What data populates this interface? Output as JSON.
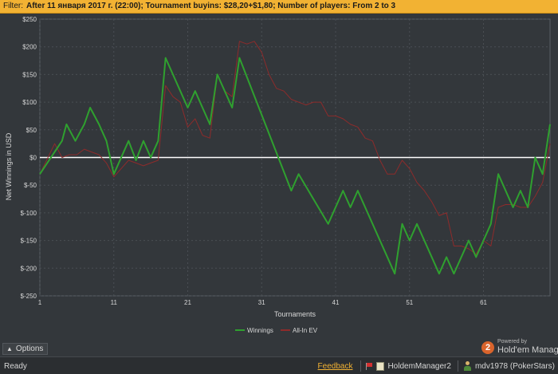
{
  "filter": {
    "label": "Filter:",
    "text": "After 11 января 2017 г. (22:00); Tournament buyins: $28,20+$1,80; Number of players: From 2 to 3"
  },
  "colors": {
    "filter_bg": "#f2b233",
    "background": "#33373b",
    "grid": "#4a4f54",
    "zero_line": "#ffffff",
    "winnings": "#2fa02f",
    "allin_ev": "#8e2b2b",
    "feedback": "#f2b233"
  },
  "chart_data": {
    "type": "line",
    "xlabel": "Tournaments",
    "ylabel": "Net Winnings in USD",
    "xlim": [
      1,
      70
    ],
    "ylim": [
      -250,
      250
    ],
    "x_ticks": [
      1,
      11,
      21,
      31,
      41,
      51,
      61
    ],
    "y_ticks": [
      {
        "value": 250,
        "label": "$250"
      },
      {
        "value": 200,
        "label": "$200"
      },
      {
        "value": 150,
        "label": "$150"
      },
      {
        "value": 100,
        "label": "$100"
      },
      {
        "value": 50,
        "label": "$50"
      },
      {
        "value": 0,
        "label": "$0"
      },
      {
        "value": -50,
        "label": "$-50"
      },
      {
        "value": -100,
        "label": "$-100"
      },
      {
        "value": -150,
        "label": "$-150"
      },
      {
        "value": -200,
        "label": "$-200"
      },
      {
        "value": -250,
        "label": "$-250"
      }
    ],
    "grid": true,
    "legend_position": "bottom-center",
    "series": [
      {
        "name": "Winnings",
        "color": "#2fa02f",
        "points": [
          [
            1,
            -30
          ],
          [
            4,
            30
          ],
          [
            4.6,
            60
          ],
          [
            5.8,
            30
          ],
          [
            7,
            60
          ],
          [
            7.8,
            90
          ],
          [
            9,
            60
          ],
          [
            10,
            30
          ],
          [
            11,
            -30
          ],
          [
            13,
            30
          ],
          [
            14,
            -5
          ],
          [
            15,
            30
          ],
          [
            16,
            0
          ],
          [
            17,
            30
          ],
          [
            18,
            180
          ],
          [
            20,
            120
          ],
          [
            21,
            90
          ],
          [
            22,
            120
          ],
          [
            24,
            60
          ],
          [
            25,
            150
          ],
          [
            27,
            90
          ],
          [
            28,
            180
          ],
          [
            35,
            -60
          ],
          [
            36,
            -30
          ],
          [
            40,
            -120
          ],
          [
            42,
            -60
          ],
          [
            43,
            -90
          ],
          [
            44,
            -60
          ],
          [
            49,
            -210
          ],
          [
            50,
            -120
          ],
          [
            51,
            -150
          ],
          [
            52,
            -120
          ],
          [
            55,
            -210
          ],
          [
            56,
            -180
          ],
          [
            57,
            -210
          ],
          [
            59,
            -150
          ],
          [
            60,
            -180
          ],
          [
            62,
            -120
          ],
          [
            63,
            -30
          ],
          [
            65,
            -90
          ],
          [
            66,
            -60
          ],
          [
            67,
            -90
          ],
          [
            68,
            0
          ],
          [
            69,
            -30
          ],
          [
            70,
            60
          ]
        ]
      },
      {
        "name": "All-In EV",
        "color": "#8e2b2b",
        "points": [
          [
            1,
            -30
          ],
          [
            3,
            25
          ],
          [
            4,
            0
          ],
          [
            5,
            5
          ],
          [
            6,
            5
          ],
          [
            7,
            15
          ],
          [
            8,
            10
          ],
          [
            9,
            5
          ],
          [
            10,
            -10
          ],
          [
            11,
            -35
          ],
          [
            13,
            -5
          ],
          [
            14,
            -10
          ],
          [
            15,
            -15
          ],
          [
            16,
            -10
          ],
          [
            17,
            -5
          ],
          [
            18,
            130
          ],
          [
            19,
            110
          ],
          [
            20,
            100
          ],
          [
            21,
            55
          ],
          [
            22,
            70
          ],
          [
            23,
            40
          ],
          [
            24,
            35
          ],
          [
            25,
            150
          ],
          [
            26,
            120
          ],
          [
            27,
            110
          ],
          [
            28,
            210
          ],
          [
            29,
            205
          ],
          [
            30,
            210
          ],
          [
            31,
            190
          ],
          [
            32,
            150
          ],
          [
            33,
            125
          ],
          [
            34,
            120
          ],
          [
            35,
            105
          ],
          [
            36,
            100
          ],
          [
            37,
            95
          ],
          [
            38,
            100
          ],
          [
            39,
            100
          ],
          [
            40,
            75
          ],
          [
            41,
            75
          ],
          [
            42,
            70
          ],
          [
            43,
            60
          ],
          [
            44,
            55
          ],
          [
            45,
            35
          ],
          [
            46,
            30
          ],
          [
            47,
            -5
          ],
          [
            48,
            -30
          ],
          [
            49,
            -30
          ],
          [
            50,
            -5
          ],
          [
            51,
            -20
          ],
          [
            52,
            -45
          ],
          [
            53,
            -60
          ],
          [
            54,
            -80
          ],
          [
            55,
            -105
          ],
          [
            56,
            -100
          ],
          [
            57,
            -160
          ],
          [
            58,
            -160
          ],
          [
            59,
            -165
          ],
          [
            60,
            -175
          ],
          [
            61,
            -150
          ],
          [
            62,
            -160
          ],
          [
            63,
            -90
          ],
          [
            64,
            -85
          ],
          [
            65,
            -85
          ],
          [
            66,
            -90
          ],
          [
            67,
            -90
          ],
          [
            68,
            -70
          ],
          [
            69,
            -45
          ],
          [
            70,
            25
          ]
        ]
      }
    ]
  },
  "options": {
    "label": "Options"
  },
  "brand": {
    "logo_char": "2",
    "powered_by": "Powered by",
    "name": "Hold'em Manager"
  },
  "status": {
    "ready": "Ready",
    "feedback": "Feedback",
    "database": "HoldemManager2",
    "player": "mdv1978 (PokerStars)"
  },
  "icons": [
    "flag-icon",
    "database-icon",
    "player-icon",
    "caret-up-icon"
  ]
}
